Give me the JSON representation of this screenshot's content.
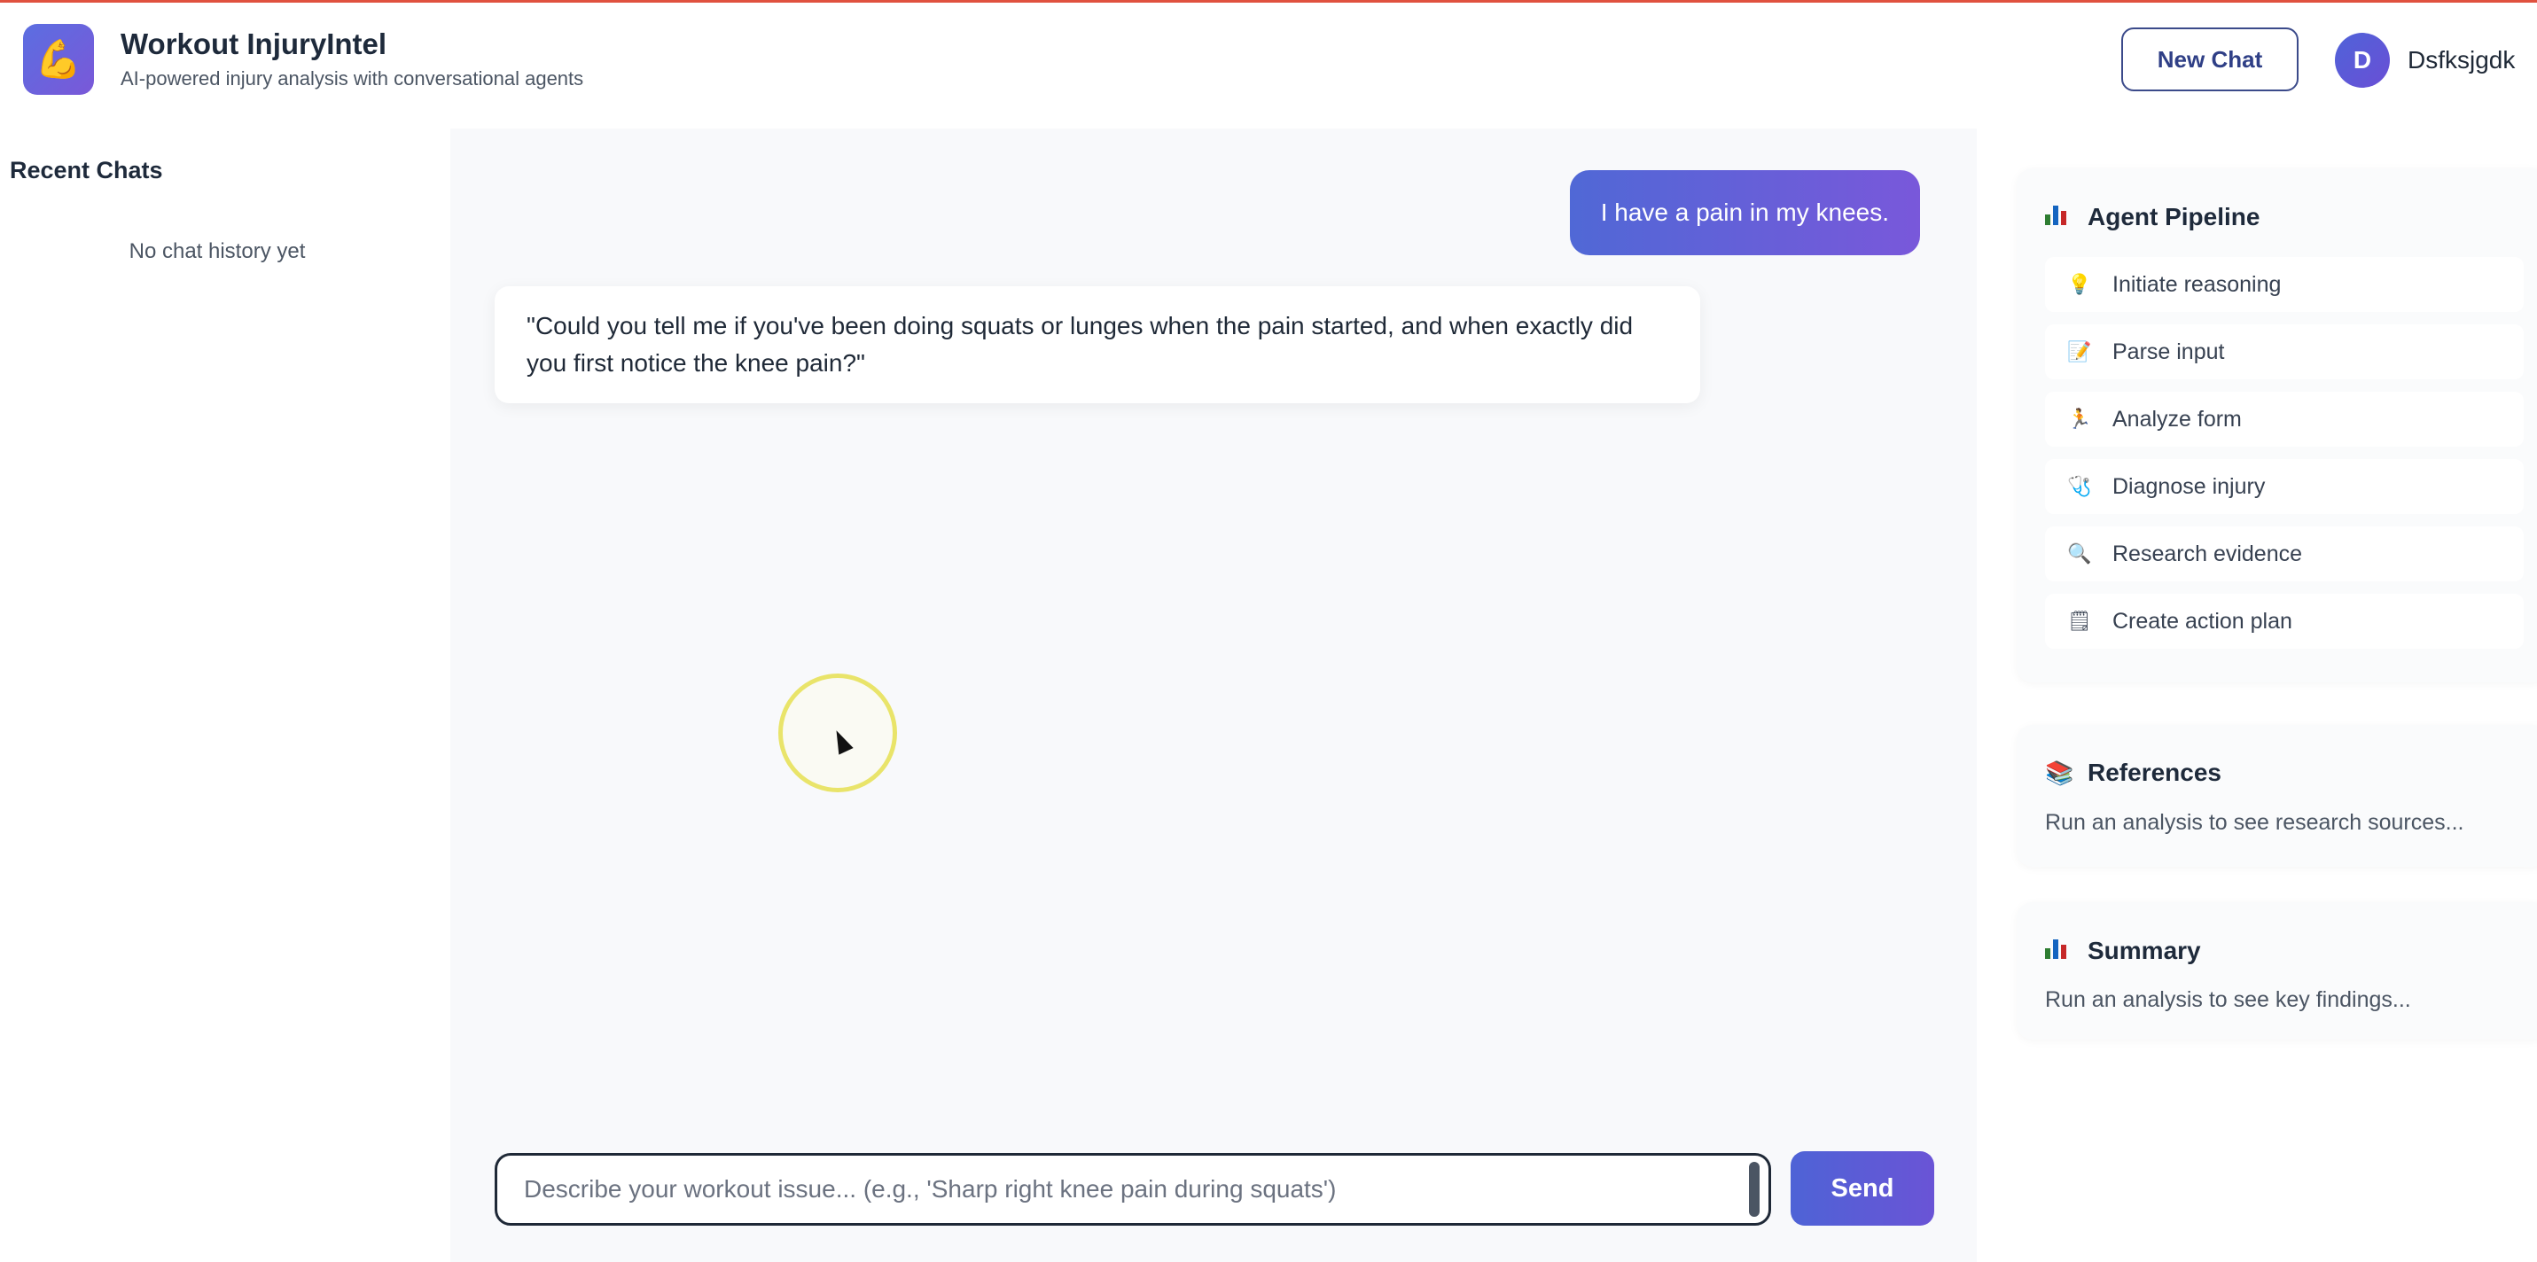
{
  "header": {
    "logo_icon": "muscle-icon",
    "title": "Workout InjuryIntel",
    "subtitle": "AI-powered injury analysis with conversational agents",
    "new_chat_label": "New Chat",
    "user": {
      "initial": "D",
      "name": "Dsfksjgdk"
    }
  },
  "sidebar": {
    "title": "Recent Chats",
    "empty_text": "No chat history yet"
  },
  "chat": {
    "messages": [
      {
        "role": "user",
        "text": "I have a pain in my knees."
      },
      {
        "role": "assistant",
        "text": "\"Could you tell me if you've been doing squats or lunges when the pain started, and when exactly did you first notice the knee pain?\""
      }
    ]
  },
  "composer": {
    "placeholder": "Describe your workout issue... (e.g., 'Sharp right knee pain during squats')",
    "value": "",
    "send_label": "Send"
  },
  "pipeline": {
    "title": "Agent Pipeline",
    "icon": "bar-chart-icon",
    "steps": [
      {
        "icon": "lightbulb-icon",
        "glyph": "💡",
        "label": "Initiate reasoning"
      },
      {
        "icon": "note-icon",
        "glyph": "📝",
        "label": "Parse input"
      },
      {
        "icon": "runner-icon",
        "glyph": "🏃",
        "label": "Analyze form"
      },
      {
        "icon": "stethoscope-icon",
        "glyph": "🩺",
        "label": "Diagnose injury"
      },
      {
        "icon": "magnifier-icon",
        "glyph": "🔍",
        "label": "Research evidence"
      },
      {
        "icon": "notepad-icon",
        "glyph": "🗒",
        "label": "Create action plan"
      }
    ]
  },
  "references": {
    "title": "References",
    "icon": "books-icon",
    "glyph": "📚",
    "text": "Run an analysis to see research sources..."
  },
  "summary": {
    "title": "Summary",
    "icon": "bar-chart-icon",
    "text": "Run an analysis to see key findings..."
  },
  "colors": {
    "accent_start": "#5068d6",
    "accent_end": "#7958da",
    "top_border": "#e0513f"
  }
}
